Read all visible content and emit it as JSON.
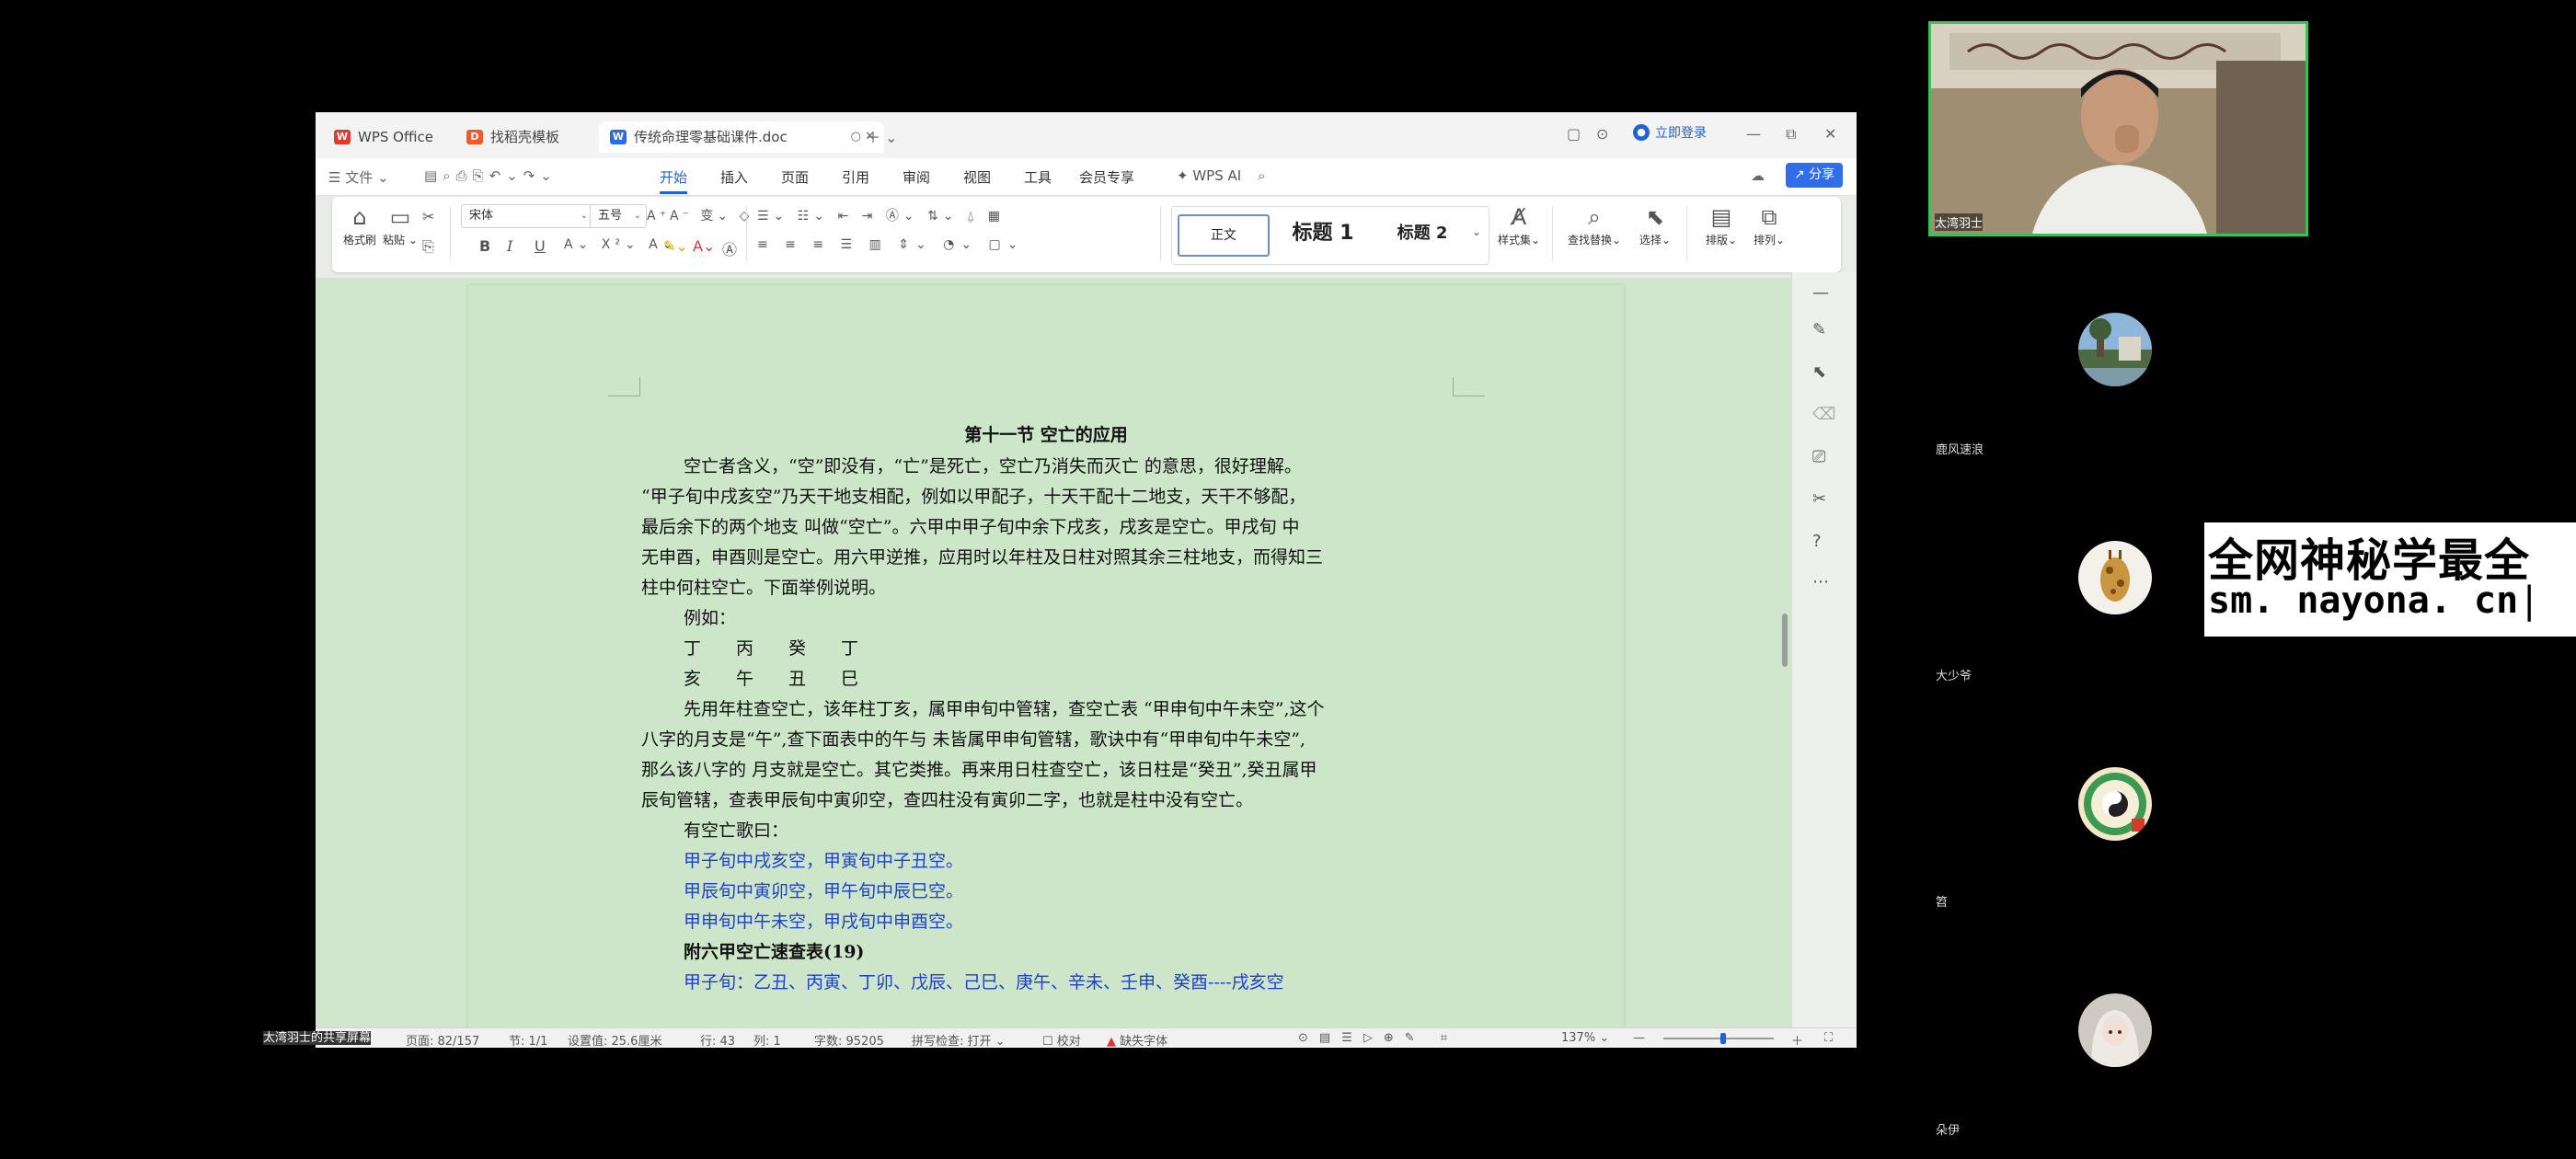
{
  "tabs": [
    {
      "label": "WPS Office",
      "icon": "wps-logo-icon",
      "color": "#e23b2e"
    },
    {
      "label": "找稻壳模板",
      "icon": "docer-icon",
      "color": "#ef5b2b"
    },
    {
      "label": "传统命理零基础课件.doc",
      "icon": "word-doc-icon",
      "color": "#2b6de0"
    }
  ],
  "window": {
    "login": "立即登录",
    "share": "分享"
  },
  "menu": {
    "file": "文件",
    "items": [
      "开始",
      "插入",
      "页面",
      "引用",
      "审阅",
      "视图",
      "工具",
      "会员专享"
    ],
    "ai": "WPS AI",
    "active": "开始"
  },
  "ribbon": {
    "format_painter": "格式刷",
    "paste": "粘贴",
    "font_name": "宋体",
    "font_size": "五号",
    "bold": "B",
    "italic": "I",
    "underline": "U",
    "font_color_a": "A",
    "style_normal": "正文",
    "style_h1": "标题 1",
    "style_h2": "标题 2",
    "style_set": "样式集",
    "find_replace": "查找替换",
    "select": "选择",
    "layout": "排版",
    "arrange": "排列"
  },
  "document": {
    "title": "第十一节 空亡的应用",
    "lines": [
      {
        "text": "空亡者含义，“空”即没有，“亡”是死亡，空亡乃消失而灭亡 的意思，很好理解。",
        "style": "ind"
      },
      {
        "text": "“甲子旬中戌亥空”乃天干地支相配，例如以甲配子，十天干配十二地支，天干不够配，",
        "style": ""
      },
      {
        "text": "最后余下的两个地支 叫做“空亡”。六甲中甲子旬中余下戌亥，戌亥是空亡。甲戌旬 中",
        "style": ""
      },
      {
        "text": "无申酉，申酉则是空亡。用六甲逆推，应用时以年柱及日柱对照其余三柱地支，而得知三",
        "style": ""
      },
      {
        "text": "柱中何柱空亡。下面举例说明。",
        "style": ""
      },
      {
        "text": "例如：",
        "style": "ind"
      },
      {
        "text": "丁　　丙　　癸　　丁",
        "style": "ind"
      },
      {
        "text": "亥　　午　　丑　　巳",
        "style": "ind"
      },
      {
        "text": "先用年柱查空亡，该年柱丁亥，属甲申旬中管辖，查空亡表 “甲申旬中午未空”,这个",
        "style": "ind"
      },
      {
        "text": "八字的月支是“午”,查下面表中的午与 未皆属甲申旬管辖，歌诀中有“甲申旬中午未空”,",
        "style": ""
      },
      {
        "text": "那么该八字的 月支就是空亡。其它类推。再来用日柱查空亡，该日柱是“癸丑”,癸丑属甲",
        "style": ""
      },
      {
        "text": "辰旬管辖，查表甲辰旬中寅卯空，查四柱没有寅卯二字，也就是柱中没有空亡。",
        "style": ""
      },
      {
        "text": "有空亡歌曰：",
        "style": "ind"
      },
      {
        "text": "甲子旬中戌亥空，甲寅旬中子丑空。",
        "style": "ind blue"
      },
      {
        "text": "甲辰旬中寅卯空，甲午旬中辰巳空。",
        "style": "ind blue"
      },
      {
        "text": "甲申旬中午未空，甲戌旬中申酉空。",
        "style": "ind blue"
      },
      {
        "text": "附六甲空亡速查表(19)",
        "style": "ind bold"
      },
      {
        "text": "甲子旬：乙丑、丙寅、丁卯、戊辰、己巳、庚午、辛未、壬申、癸酉----戌亥空",
        "style": "ind blue"
      }
    ]
  },
  "status": {
    "page": "页面: 82/157",
    "section": "节: 1/1",
    "setting": "设置值: 25.6厘米",
    "row": "行: 43",
    "col": "列: 1",
    "words": "字数: 95205",
    "spell": "拼写检查: 打开",
    "proof": "校对",
    "missing_font": "缺失字体",
    "zoom": "137%"
  },
  "sharer_label": "太湾羽士的共享屏幕",
  "participants": [
    {
      "name": "太湾羽士"
    },
    {
      "name": "鹿风速浪"
    },
    {
      "name": "大少爷"
    },
    {
      "name": "笤"
    },
    {
      "name": "朵伊"
    }
  ],
  "ad": {
    "line1": "全网神秘学最全",
    "line2": "sm. nayona. cn"
  }
}
